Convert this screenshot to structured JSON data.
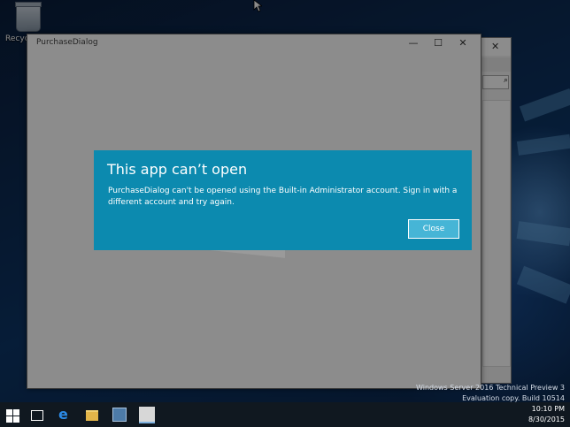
{
  "desktop": {
    "recycle_bin_label": "Recycle Bin"
  },
  "background_window": {
    "close_glyph": "✕",
    "help_glyph": "?",
    "search_glyph": "⌕"
  },
  "app_window": {
    "title": "PurchaseDialog",
    "minimize_glyph": "—",
    "maximize_glyph": "☐",
    "close_glyph": "✕"
  },
  "modal": {
    "title": "This app can’t open",
    "message": "PurchaseDialog can't be opened using the Built-in Administrator account. Sign in with a different account and try again.",
    "close_label": "Close"
  },
  "watermark": {
    "line1": "Windows Server 2016 Technical Preview 3",
    "line2": "Evaluation copy. Build 10514",
    "time": "10:10 PM",
    "date": "8/30/2015"
  },
  "taskbar": {
    "edge_glyph": "e"
  },
  "colors": {
    "modal_bg": "#0c8aaf",
    "close_button_bg": "#46b5d6",
    "taskbar_bg": "#101820"
  }
}
